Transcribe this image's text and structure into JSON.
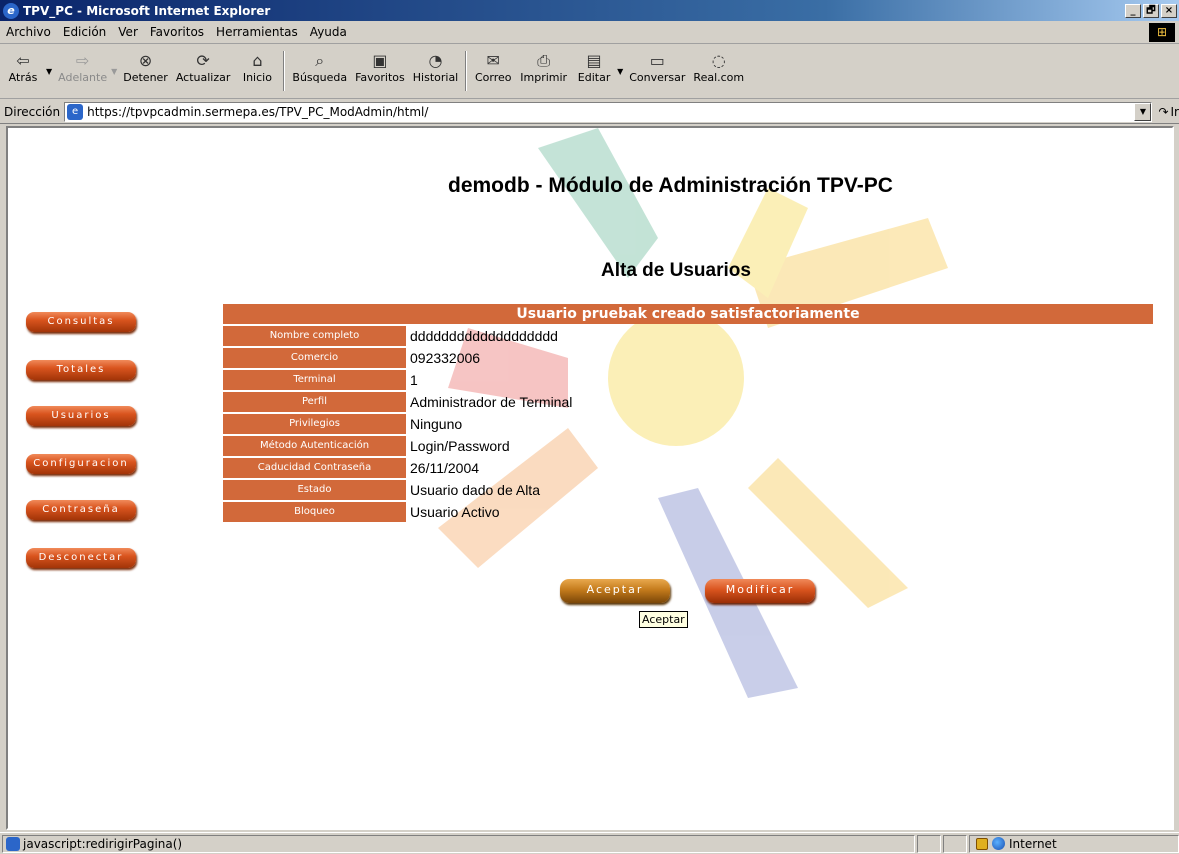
{
  "window": {
    "title": "TPV_PC - Microsoft Internet Explorer",
    "controls": [
      "_",
      "🗗",
      "×"
    ]
  },
  "menu": [
    "Archivo",
    "Edición",
    "Ver",
    "Favoritos",
    "Herramientas",
    "Ayuda"
  ],
  "toolbar": {
    "back": "Atrás",
    "forward": "Adelante",
    "stop": "Detener",
    "refresh": "Actualizar",
    "home": "Inicio",
    "search": "Búsqueda",
    "favorites": "Favoritos",
    "history": "Historial",
    "mail": "Correo",
    "print": "Imprimir",
    "edit": "Editar",
    "discuss": "Conversar",
    "realcom": "Real.com"
  },
  "address": {
    "label": "Dirección",
    "url": "https://tpvpcadmin.sermepa.es/TPV_PC_ModAdmin/html/",
    "go": "Ir"
  },
  "page": {
    "title": "demodb - Módulo de Administración TPV-PC",
    "subtitle": "Alta de Usuarios",
    "nav": [
      "Consultas",
      "Totales",
      "Usuarios",
      "Configuracion",
      "Contraseña",
      "Desconectar"
    ],
    "result_header": "Usuario pruebak creado satisfactoriamente",
    "rows": [
      {
        "label": "Nombre completo",
        "value": "ddddddddddddddddddd"
      },
      {
        "label": "Comercio",
        "value": "092332006"
      },
      {
        "label": "Terminal",
        "value": "1"
      },
      {
        "label": "Perfil",
        "value": "Administrador de Terminal"
      },
      {
        "label": "Privilegios",
        "value": "Ninguno"
      },
      {
        "label": "Método Autenticación",
        "value": "Login/Password"
      },
      {
        "label": "Caducidad Contraseña",
        "value": "26/11/2004"
      },
      {
        "label": "Estado",
        "value": "Usuario dado de Alta"
      },
      {
        "label": "Bloqueo",
        "value": "Usuario Activo"
      }
    ],
    "aceptar": "Aceptar",
    "modificar": "Modificar",
    "tooltip": "Aceptar"
  },
  "status": {
    "text": "javascript:redirigirPagina()",
    "zone": "Internet"
  },
  "colors": {
    "accent": "#d2693a",
    "aceptar": "#c47b1c"
  }
}
